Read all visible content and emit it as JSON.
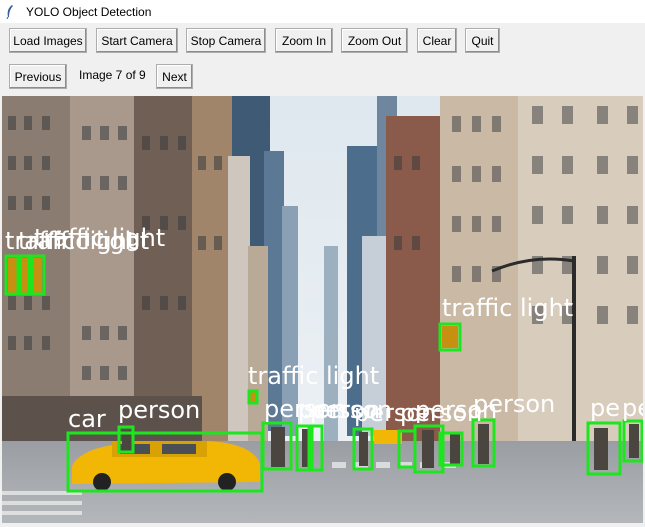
{
  "window": {
    "title": "YOLO Object Detection",
    "icon": "feather-icon"
  },
  "toolbar": {
    "load_images": "Load Images",
    "start_camera": "Start Camera",
    "stop_camera": "Stop Camera",
    "zoom_in": "Zoom In",
    "zoom_out": "Zoom Out",
    "clear": "Clear",
    "quit": "Quit"
  },
  "navigation": {
    "previous": "Previous",
    "image_counter": "Image 7 of 9",
    "next": "Next"
  },
  "detections": {
    "traffic_light": "traffic light",
    "car": "car",
    "person": "person",
    "person_partial": "pe",
    "person_partial_2": "pers"
  },
  "colors": {
    "box": "#1ee61e",
    "label_text": "#ffffff",
    "taxi": "#f2b705"
  }
}
